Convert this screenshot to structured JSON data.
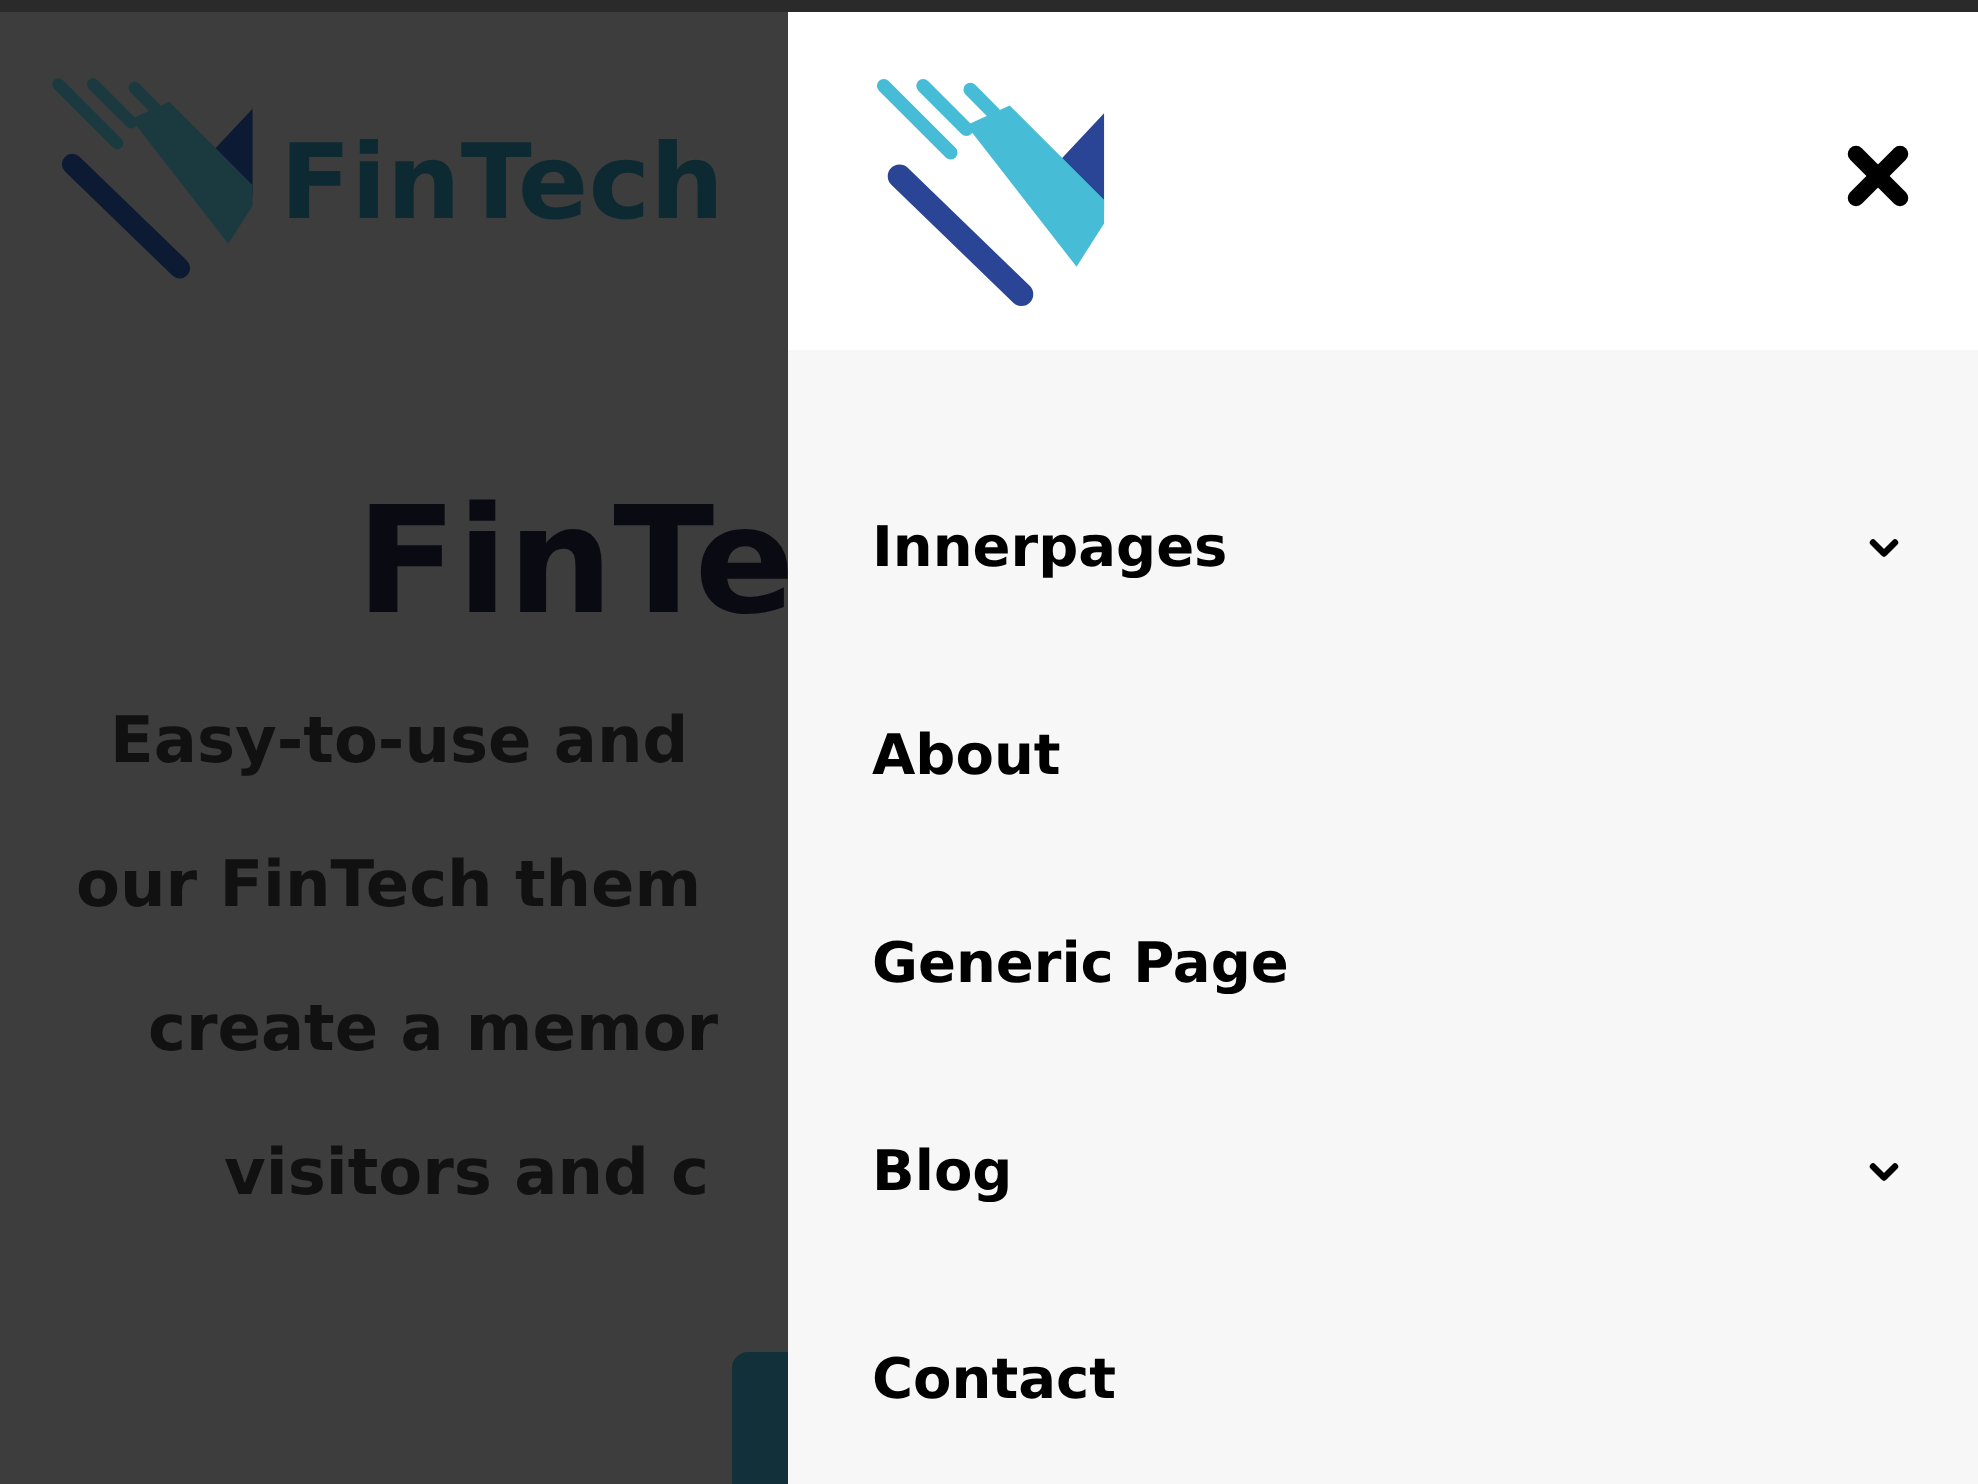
{
  "page": {
    "logo_text": "FinTech",
    "heading": "FinTe",
    "intro_lines": [
      "Easy-to-use and",
      "our FinTech them",
      "create a memor",
      "visitors and c"
    ]
  },
  "drawer": {
    "menu": [
      {
        "label": "Innerpages",
        "has_submenu": true
      },
      {
        "label": "About",
        "has_submenu": false
      },
      {
        "label": "Generic Page",
        "has_submenu": false
      },
      {
        "label": "Blog",
        "has_submenu": true
      },
      {
        "label": "Contact",
        "has_submenu": false
      }
    ]
  }
}
